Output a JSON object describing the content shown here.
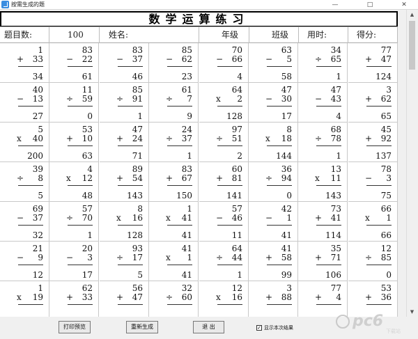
{
  "window": {
    "title": "按需生成的题",
    "min_label": "—",
    "max_label": "□",
    "close_label": "✕"
  },
  "banner": "数学运算练习",
  "header": {
    "question_count_label": "题目数:",
    "question_count_value": "100",
    "name_label": "姓名:",
    "grade_label": "年级",
    "class_label": "班级",
    "time_label": "用时:",
    "score_label": "得分:"
  },
  "problems": [
    [
      [
        "1",
        "+",
        "33",
        "34"
      ],
      [
        "83",
        "−",
        "22",
        "61"
      ],
      [
        "83",
        "−",
        "37",
        "46"
      ],
      [
        "85",
        "−",
        "62",
        "23"
      ],
      [
        "70",
        "−",
        "66",
        "4"
      ],
      [
        "63",
        "−",
        "5",
        "58"
      ],
      [
        "34",
        "÷",
        "65",
        "1"
      ],
      [
        "77",
        "+",
        "47",
        "124"
      ]
    ],
    [
      [
        "40",
        "−",
        "13",
        "27"
      ],
      [
        "11",
        "÷",
        "59",
        "0"
      ],
      [
        "85",
        "÷",
        "91",
        "1"
      ],
      [
        "61",
        "÷",
        "7",
        "9"
      ],
      [
        "64",
        "x",
        "2",
        "128"
      ],
      [
        "47",
        "−",
        "30",
        "17"
      ],
      [
        "47",
        "−",
        "43",
        "4"
      ],
      [
        "3",
        "+",
        "62",
        "65"
      ]
    ],
    [
      [
        "5",
        "x",
        "40",
        "200"
      ],
      [
        "53",
        "+",
        "10",
        "63"
      ],
      [
        "47",
        "+",
        "24",
        "71"
      ],
      [
        "24",
        "÷",
        "37",
        "1"
      ],
      [
        "97",
        "÷",
        "51",
        "2"
      ],
      [
        "8",
        "x",
        "18",
        "144"
      ],
      [
        "68",
        "÷",
        "78",
        "1"
      ],
      [
        "45",
        "+",
        "92",
        "137"
      ]
    ],
    [
      [
        "39",
        "÷",
        "8",
        "5"
      ],
      [
        "4",
        "x",
        "12",
        "48"
      ],
      [
        "89",
        "+",
        "54",
        "143"
      ],
      [
        "83",
        "+",
        "67",
        "150"
      ],
      [
        "60",
        "+",
        "81",
        "141"
      ],
      [
        "36",
        "÷",
        "94",
        "0"
      ],
      [
        "13",
        "x",
        "11",
        "143"
      ],
      [
        "78",
        "−",
        "3",
        "75"
      ]
    ],
    [
      [
        "69",
        "−",
        "37",
        "32"
      ],
      [
        "57",
        "÷",
        "70",
        "1"
      ],
      [
        "8",
        "x",
        "16",
        "128"
      ],
      [
        "1",
        "x",
        "41",
        "41"
      ],
      [
        "57",
        "−",
        "46",
        "11"
      ],
      [
        "42",
        "−",
        "1",
        "41"
      ],
      [
        "73",
        "+",
        "41",
        "114"
      ],
      [
        "66",
        "x",
        "1",
        "66"
      ]
    ],
    [
      [
        "21",
        "−",
        "9",
        "12"
      ],
      [
        "20",
        "−",
        "3",
        "17"
      ],
      [
        "93",
        "÷",
        "17",
        "5"
      ],
      [
        "41",
        "x",
        "1",
        "41"
      ],
      [
        "64",
        "÷",
        "44",
        "1"
      ],
      [
        "41",
        "+",
        "58",
        "99"
      ],
      [
        "35",
        "+",
        "71",
        "106"
      ],
      [
        "12",
        "÷",
        "85",
        "0"
      ]
    ],
    [
      [
        "1",
        "x",
        "19",
        ""
      ],
      [
        "62",
        "+",
        "33",
        ""
      ],
      [
        "56",
        "+",
        "47",
        ""
      ],
      [
        "32",
        "÷",
        "60",
        ""
      ],
      [
        "12",
        "x",
        "16",
        ""
      ],
      [
        "3",
        "+",
        "88",
        ""
      ],
      [
        "77",
        "+",
        "4",
        ""
      ],
      [
        "53",
        "+",
        "36",
        ""
      ]
    ]
  ],
  "buttons": {
    "print": "打印预览",
    "regenerate": "重新生成",
    "exit": "退 出"
  },
  "checkbox": {
    "label": "显示本次结果",
    "checked": true,
    "mark": "✓"
  },
  "scroll": {
    "up": "▲",
    "down": "▼"
  },
  "watermark": {
    "text": "pc6",
    "sub": "下载站"
  },
  "colors": {
    "grid_line": "#c8c8c8",
    "banner_border": "#000000",
    "background": "#f0f0f0"
  }
}
